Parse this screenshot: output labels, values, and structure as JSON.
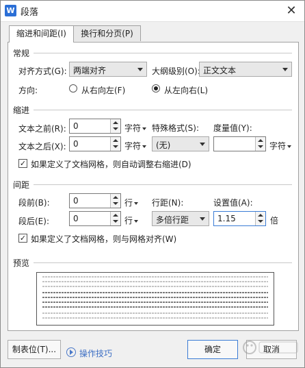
{
  "window": {
    "title": "段落",
    "app_icon_letter": "W"
  },
  "tabs": [
    {
      "label": "缩进和间距(I)",
      "active": true
    },
    {
      "label": "换行和分页(P)",
      "active": false
    }
  ],
  "general": {
    "heading": "常规",
    "alignment_label": "对齐方式(G):",
    "alignment_value": "两端对齐",
    "outline_label": "大纲级别(O):",
    "outline_value": "正文文本",
    "direction_label": "方向:",
    "direction_rtl": "从右向左(F)",
    "direction_ltr": "从左向右(L)",
    "direction_selected": "ltr"
  },
  "indent": {
    "heading": "缩进",
    "before_label": "文本之前(R):",
    "before_value": "0",
    "before_unit": "字符",
    "after_label": "文本之后(X):",
    "after_value": "0",
    "after_unit": "字符",
    "special_label": "特殊格式(S):",
    "special_value": "(无)",
    "measure_label": "度量值(Y):",
    "measure_value": "",
    "measure_unit": "字符",
    "auto_adjust_label": "如果定义了文档网格，则自动调整右缩进(D)",
    "auto_adjust_checked": true
  },
  "spacing": {
    "heading": "间距",
    "before_label": "段前(B):",
    "before_value": "0",
    "before_unit": "行",
    "after_label": "段后(E):",
    "after_value": "0",
    "after_unit": "行",
    "line_label": "行距(N):",
    "line_value": "多倍行距",
    "setting_label": "设置值(A):",
    "setting_value": "1.15",
    "setting_unit": "倍",
    "grid_align_label": "如果定义了文档网格，则与网格对齐(W)",
    "grid_align_checked": true
  },
  "preview": {
    "heading": "预览"
  },
  "footer": {
    "tabs_button": "制表位(T)...",
    "tips_link": "操作技巧",
    "ok_button": "确定",
    "cancel_button": "取消"
  },
  "colors": {
    "accent": "#3a7bd5",
    "panel": "#ffffff",
    "dialog_bg": "#f0f0f0"
  },
  "icons": {
    "close": "close-icon",
    "tips": "play-circle-icon",
    "watermark": "baidu-jingyan-watermark"
  }
}
